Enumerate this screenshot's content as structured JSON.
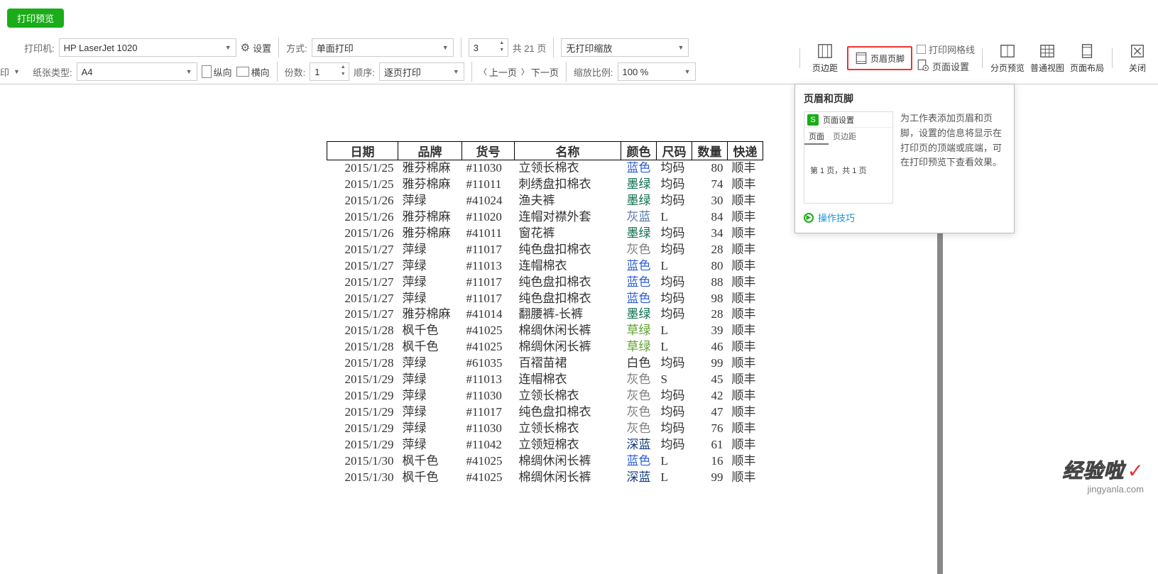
{
  "preview_label": "打印预览",
  "toolbar": {
    "printer_label": "打印机:",
    "printer_value": "HP LaserJet 1020",
    "settings_label": "设置",
    "mode_label": "方式:",
    "mode_value": "单面打印",
    "page_num": "3",
    "total_pages_label": "共 21 页",
    "zoom_mode_label_none": "无打印缩放",
    "paper_type_label": "纸张类型:",
    "paper_type_value": "A4",
    "orient_portrait": "纵向",
    "orient_landscape": "横向",
    "copies_label": "份数:",
    "copies_value": "1",
    "order_label": "顺序:",
    "order_value": "逐页打印",
    "prev_page": "上一页",
    "next_page": "下一页",
    "zoom_label": "缩放比例:",
    "zoom_value": "100 %",
    "margins": "页边距",
    "headerfooter": "页眉页脚",
    "gridlines_label": "打印网格线",
    "page_settings": "页面设置",
    "split_preview": "分页预览",
    "normal_view": "普通视图",
    "page_layout": "页面布局",
    "close": "关闭",
    "truncated_print_prefix": "印"
  },
  "tooltip": {
    "title": "页眉和页脚",
    "mini_icon": "S",
    "mini_header": "页面设置",
    "tab1": "页面",
    "tab2": "页边距",
    "body_text": "第 1 页，共 1 页",
    "desc": "为工作表添加页眉和页脚，设置的信息将显示在打印页的顶端或底端，可在打印预览下查看效果。",
    "link": "操作技巧"
  },
  "table": {
    "headers": [
      "日期",
      "品牌",
      "货号",
      "名称",
      "颜色",
      "尺码",
      "数量",
      "快递"
    ],
    "rows": [
      {
        "date": "2015/1/25",
        "brand": "雅芬棉麻",
        "sku": "#11030",
        "name": "立领长棉衣",
        "color": "蓝色",
        "ccls": "col-blue",
        "size": "均码",
        "qty": 80,
        "ship": "顺丰"
      },
      {
        "date": "2015/1/25",
        "brand": "雅芬棉麻",
        "sku": "#11011",
        "name": "刺绣盘扣棉衣",
        "color": "墨绿",
        "ccls": "col-mgreen",
        "size": "均码",
        "qty": 74,
        "ship": "顺丰"
      },
      {
        "date": "2015/1/26",
        "brand": "萍绿",
        "sku": "#41024",
        "name": "渔夫裤",
        "color": "墨绿",
        "ccls": "col-mgreen",
        "size": "均码",
        "qty": 30,
        "ship": "顺丰"
      },
      {
        "date": "2015/1/26",
        "brand": "雅芬棉麻",
        "sku": "#11020",
        "name": "连帽对襟外套",
        "color": "灰蓝",
        "ccls": "col-gblue",
        "size": "L",
        "qty": 84,
        "ship": "顺丰"
      },
      {
        "date": "2015/1/26",
        "brand": "雅芬棉麻",
        "sku": "#41011",
        "name": "窗花裤",
        "color": "墨绿",
        "ccls": "col-mgreen",
        "size": "均码",
        "qty": 34,
        "ship": "顺丰"
      },
      {
        "date": "2015/1/27",
        "brand": "萍绿",
        "sku": "#11017",
        "name": "纯色盘扣棉衣",
        "color": "灰色",
        "ccls": "col-gray",
        "size": "均码",
        "qty": 28,
        "ship": "顺丰"
      },
      {
        "date": "2015/1/27",
        "brand": "萍绿",
        "sku": "#11013",
        "name": "连帽棉衣",
        "color": "蓝色",
        "ccls": "col-blue",
        "size": "L",
        "qty": 80,
        "ship": "顺丰"
      },
      {
        "date": "2015/1/27",
        "brand": "萍绿",
        "sku": "#11017",
        "name": "纯色盘扣棉衣",
        "color": "蓝色",
        "ccls": "col-blue",
        "size": "均码",
        "qty": 88,
        "ship": "顺丰"
      },
      {
        "date": "2015/1/27",
        "brand": "萍绿",
        "sku": "#11017",
        "name": "纯色盘扣棉衣",
        "color": "蓝色",
        "ccls": "col-blue",
        "size": "均码",
        "qty": 98,
        "ship": "顺丰"
      },
      {
        "date": "2015/1/27",
        "brand": "雅芬棉麻",
        "sku": "#41014",
        "name": "翻腰裤-长裤",
        "color": "墨绿",
        "ccls": "col-mgreen",
        "size": "均码",
        "qty": 28,
        "ship": "顺丰"
      },
      {
        "date": "2015/1/28",
        "brand": "枫千色",
        "sku": "#41025",
        "name": "棉绸休闲长裤",
        "color": "草绿",
        "ccls": "col-ggreen",
        "size": "L",
        "qty": 39,
        "ship": "顺丰"
      },
      {
        "date": "2015/1/28",
        "brand": "枫千色",
        "sku": "#41025",
        "name": "棉绸休闲长裤",
        "color": "草绿",
        "ccls": "col-ggreen",
        "size": "L",
        "qty": 46,
        "ship": "顺丰"
      },
      {
        "date": "2015/1/28",
        "brand": "萍绿",
        "sku": "#61035",
        "name": "百褶苗裙",
        "color": "白色",
        "ccls": "col-white",
        "size": "均码",
        "qty": 99,
        "ship": "顺丰"
      },
      {
        "date": "2015/1/29",
        "brand": "萍绿",
        "sku": "#11013",
        "name": "连帽棉衣",
        "color": "灰色",
        "ccls": "col-gray",
        "size": "S",
        "qty": 45,
        "ship": "顺丰"
      },
      {
        "date": "2015/1/29",
        "brand": "萍绿",
        "sku": "#11030",
        "name": "立领长棉衣",
        "color": "灰色",
        "ccls": "col-gray",
        "size": "均码",
        "qty": 42,
        "ship": "顺丰"
      },
      {
        "date": "2015/1/29",
        "brand": "萍绿",
        "sku": "#11017",
        "name": "纯色盘扣棉衣",
        "color": "灰色",
        "ccls": "col-gray",
        "size": "均码",
        "qty": 47,
        "ship": "顺丰"
      },
      {
        "date": "2015/1/29",
        "brand": "萍绿",
        "sku": "#11030",
        "name": "立领长棉衣",
        "color": "灰色",
        "ccls": "col-gray",
        "size": "均码",
        "qty": 76,
        "ship": "顺丰"
      },
      {
        "date": "2015/1/29",
        "brand": "萍绿",
        "sku": "#11042",
        "name": "立领短棉衣",
        "color": "深蓝",
        "ccls": "col-dblue",
        "size": "均码",
        "qty": 61,
        "ship": "顺丰"
      },
      {
        "date": "2015/1/30",
        "brand": "枫千色",
        "sku": "#41025",
        "name": "棉绸休闲长裤",
        "color": "蓝色",
        "ccls": "col-blue",
        "size": "L",
        "qty": 16,
        "ship": "顺丰"
      },
      {
        "date": "2015/1/30",
        "brand": "枫千色",
        "sku": "#41025",
        "name": "棉绸休闲长裤",
        "color": "深蓝",
        "ccls": "col-dblue",
        "size": "L",
        "qty": 99,
        "ship": "顺丰"
      }
    ]
  },
  "watermark": {
    "line1": "经验啦",
    "line2": "jingyanla.com"
  }
}
